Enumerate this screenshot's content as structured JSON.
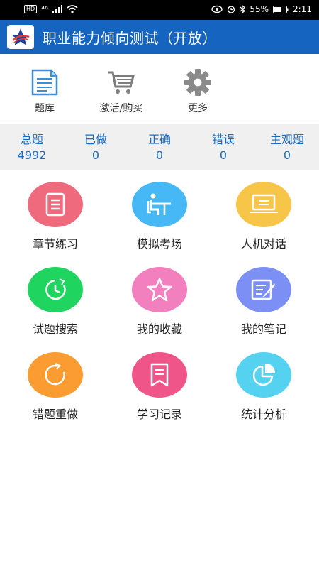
{
  "status_bar": {
    "network": "⁴⁶",
    "battery": "55%",
    "time": "2:11"
  },
  "app": {
    "title": "职业能力倾向测试（开放）"
  },
  "quick_actions": [
    {
      "label": "题库",
      "icon": "document-icon"
    },
    {
      "label": "激活/购买",
      "icon": "cart-icon"
    },
    {
      "label": "更多",
      "icon": "gear-icon"
    }
  ],
  "stats": [
    {
      "label": "总题",
      "value": "4992"
    },
    {
      "label": "已做",
      "value": "0"
    },
    {
      "label": "正确",
      "value": "0"
    },
    {
      "label": "错误",
      "value": "0"
    },
    {
      "label": "主观题",
      "value": "0"
    }
  ],
  "features": [
    {
      "label": "章节练习",
      "icon": "notebook-icon",
      "color": "#f06a7e"
    },
    {
      "label": "模拟考场",
      "icon": "desk-icon",
      "color": "#46b8f5"
    },
    {
      "label": "人机对话",
      "icon": "laptop-icon",
      "color": "#f7c548"
    },
    {
      "label": "试题搜索",
      "icon": "clock-icon",
      "color": "#1fd55f"
    },
    {
      "label": "我的收藏",
      "icon": "star-icon",
      "color": "#f27fbe"
    },
    {
      "label": "我的笔记",
      "icon": "note-icon",
      "color": "#7b8ff4"
    },
    {
      "label": "错题重做",
      "icon": "refresh-icon",
      "color": "#fb9c33"
    },
    {
      "label": "学习记录",
      "icon": "bookmark-icon",
      "color": "#f0558a"
    },
    {
      "label": "统计分析",
      "icon": "pie-chart-icon",
      "color": "#55d2ef"
    }
  ]
}
